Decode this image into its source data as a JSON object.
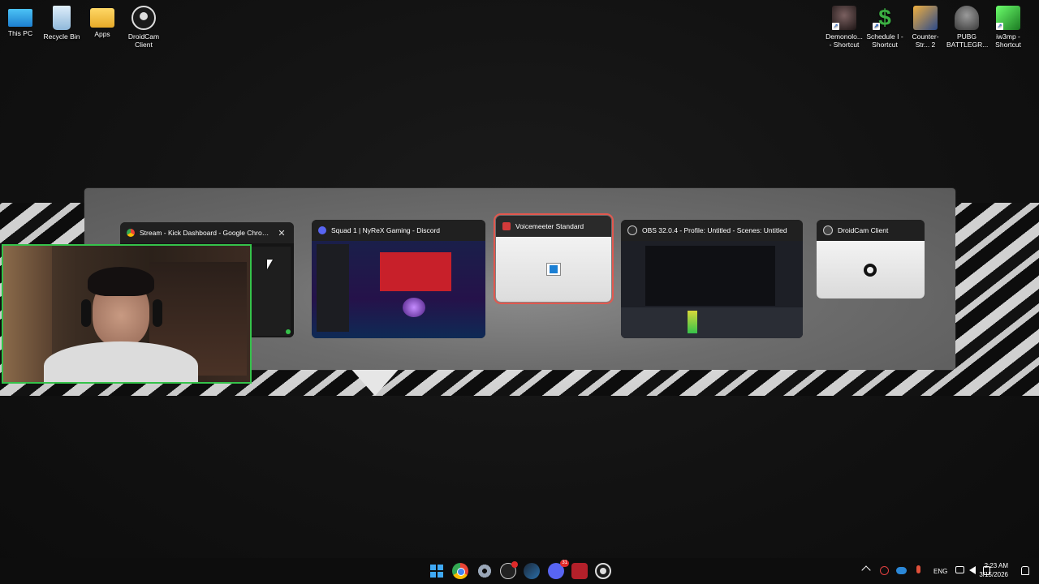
{
  "desktop_icons_left": [
    {
      "name": "this-pc",
      "label": "This PC",
      "icon": "monitor-icon",
      "color": "#29a8e8"
    },
    {
      "name": "recycle-bin",
      "label": "Recycle Bin",
      "icon": "recycle-bin-icon",
      "color": "#9ac7e8"
    },
    {
      "name": "apps",
      "label": "Apps",
      "icon": "folder-icon",
      "color": "#f0c040"
    },
    {
      "name": "droidcam-client",
      "label": "DroidCam Client",
      "icon": "camera-icon",
      "color": "#1a1a1a"
    }
  ],
  "desktop_icons_right": [
    {
      "name": "demonologist-shortcut",
      "label": "Demonolo... - Shortcut",
      "icon": "game-icon",
      "color": "#3b2a2a"
    },
    {
      "name": "schedule-shortcut",
      "label": "Schedule I - Shortcut",
      "icon": "dollar-icon",
      "color": "#3cb043"
    },
    {
      "name": "counter-strike-2",
      "label": "Counter-Str... 2",
      "icon": "cs2-icon",
      "color": "#e89a2a"
    },
    {
      "name": "pubg-battlegrounds",
      "label": "PUBG BATTLEGR...",
      "icon": "helmet-icon",
      "color": "#5a5a5a"
    },
    {
      "name": "iw3mp-shortcut",
      "label": "iw3mp - Shortcut",
      "icon": "cod4-icon",
      "color": "#2fae3a"
    }
  ],
  "switcher": {
    "windows": [
      {
        "id": "chrome",
        "title": "Stream - Kick Dashboard - Google Chrome",
        "icon": "chrome-icon",
        "has_close": true,
        "close_glyph": "✕"
      },
      {
        "id": "discord",
        "title": "Squad 1 | NyReX Gaming - Discord",
        "icon": "discord-icon"
      },
      {
        "id": "voicemeeter",
        "title": "Voicemeeter Standard",
        "icon": "voicemeeter-icon",
        "selected": true
      },
      {
        "id": "obs",
        "title": "OBS 32.0.4 - Profile: Untitled - Scenes: Untitled",
        "icon": "obs-icon"
      },
      {
        "id": "droidcam",
        "title": "DroidCam Client",
        "icon": "droidcam-icon"
      }
    ]
  },
  "taskbar": {
    "apps": [
      "windows-start-icon",
      "chrome-icon",
      "settings-icon",
      "obs-icon",
      "steam-icon",
      "discord-icon",
      "voicemeeter-icon",
      "droidcam-icon"
    ],
    "discord_badge": "31",
    "tray": {
      "language": "ENG",
      "time": "2:23 AM",
      "date": "3/15/2026"
    }
  },
  "colors": {
    "selected_outline": "#e2584f",
    "webcam_border": "#35c24a",
    "taskbar": "#0d0d0d"
  }
}
